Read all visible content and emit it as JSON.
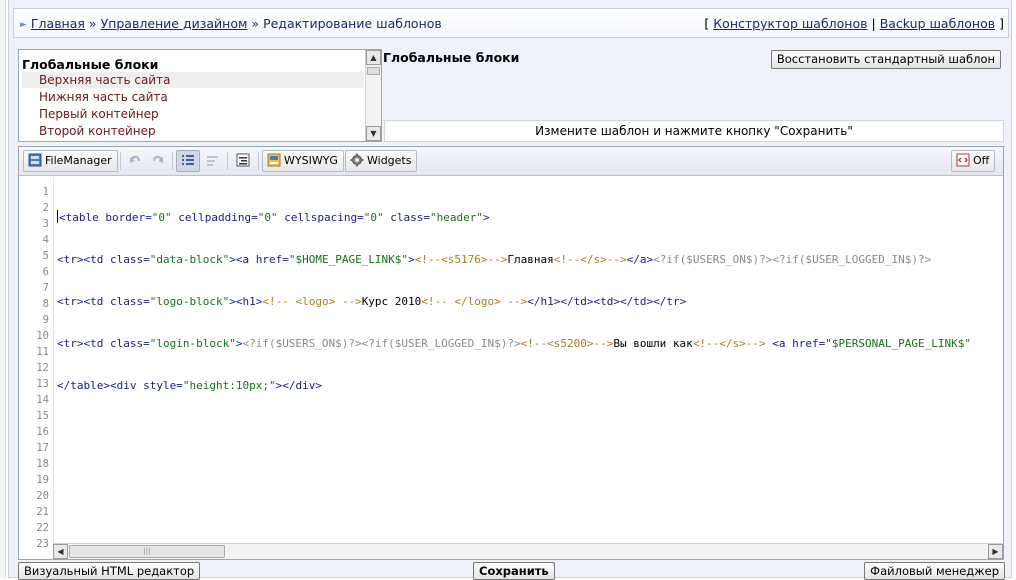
{
  "breadcrumb": {
    "home": "Главная",
    "sep": "»",
    "design": "Управление дизайном",
    "current": "Редактирование шаблонов"
  },
  "top_links": {
    "open": "[",
    "constructor": "Конструктор шаблонов",
    "divider": "|",
    "backup": "Backup шаблонов",
    "close": "]"
  },
  "blocks": {
    "title": "Глобальные блоки",
    "items": [
      "Верхняя часть сайта",
      "Нижняя часть сайта",
      "Первый контейнер",
      "Второй контейнер"
    ]
  },
  "panel": {
    "title": "Глобальные блоки",
    "restore_label": "Восстановить стандартный шаблон",
    "hint": "Измените шаблон и нажмите кнопку \"Сохранить\""
  },
  "toolbar": {
    "filemanager": "FileManager",
    "wysiwyg": "WYSIWYG",
    "widgets": "Widgets",
    "off": "Off"
  },
  "editor": {
    "line_numbers": [
      "1",
      "2",
      "3",
      "4",
      "5",
      "6",
      "7",
      "8",
      "9",
      "10",
      "11",
      "12",
      "13",
      "14",
      "15",
      "16",
      "17",
      "18",
      "19",
      "20",
      "21",
      "22",
      "23"
    ]
  },
  "bottom": {
    "visual_editor": "Визуальный HTML редактор",
    "save": "Сохранить",
    "file_manager": "Файловый менеджер"
  },
  "colors": {
    "tag": "#1a1a8c",
    "value": "#1a6e1a",
    "comment": "#b07a20",
    "php": "#8a8a8a",
    "block_item": "#6b1818"
  }
}
